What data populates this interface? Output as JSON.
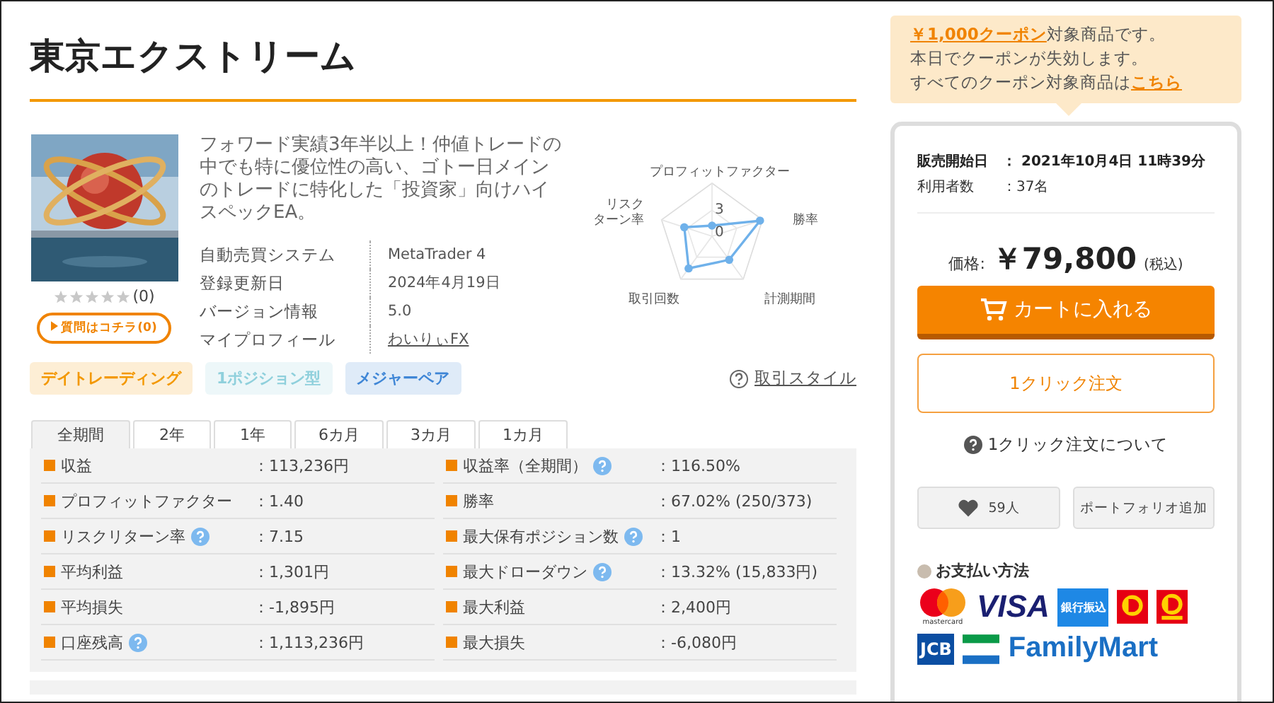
{
  "title": "東京エクストリーム",
  "product": {
    "rating_count": "(0)",
    "stars": 0,
    "question_button": "質問はコチラ(0)",
    "description": "フォワード実績3年半以上！仲値トレードの中でも特に優位性の高い、ゴトー日メインのトレードに特化した「投資家」向けハイスペックEA。",
    "specs": [
      {
        "label": "自動売買システム",
        "value": "MetaTrader 4",
        "link": false
      },
      {
        "label": "登録更新日",
        "value": "2024年4月19日",
        "link": false
      },
      {
        "label": "バージョン情報",
        "value": "5.0",
        "link": false
      },
      {
        "label": "マイプロフィール",
        "value": "わいりぃFX",
        "link": true
      }
    ],
    "tags": [
      {
        "label": "デイトレーディング",
        "color": "#f39800"
      },
      {
        "label": "1ポジション型",
        "color": "#8fd0dc"
      },
      {
        "label": "メジャーペア",
        "color": "#3f86d6"
      }
    ]
  },
  "radar": {
    "axes": [
      {
        "lines": [
          "プロフィットファクター"
        ]
      },
      {
        "lines": [
          "勝率"
        ]
      },
      {
        "lines": [
          "計測期間"
        ]
      },
      {
        "lines": [
          "取引回数"
        ]
      },
      {
        "lines": [
          "リスク",
          "ターン率"
        ]
      }
    ],
    "tick_high": "3",
    "tick_low": "0",
    "style_link": "取引スタイル"
  },
  "period_tabs": [
    {
      "label": "全期間",
      "selected": true
    },
    {
      "label": "2年",
      "selected": false
    },
    {
      "label": "1年",
      "selected": false
    },
    {
      "label": "6カ月",
      "selected": false
    },
    {
      "label": "3カ月",
      "selected": false
    },
    {
      "label": "1カ月",
      "selected": false
    }
  ],
  "stats_left": [
    {
      "label": "収益",
      "help": false,
      "value": "：113,236円"
    },
    {
      "label": "プロフィットファクター",
      "help": false,
      "value": "：1.40"
    },
    {
      "label": "リスクリターン率",
      "help": true,
      "value": "：7.15"
    },
    {
      "label": "平均利益",
      "help": false,
      "value": "：1,301円"
    },
    {
      "label": "平均損失",
      "help": false,
      "value": "：-1,895円"
    },
    {
      "label": "口座残高",
      "help": true,
      "value": "：1,113,236円"
    }
  ],
  "stats_right": [
    {
      "label": "収益率（全期間）",
      "help": true,
      "value": "：116.50%"
    },
    {
      "label": "勝率",
      "help": false,
      "value": "：67.02% (250/373)"
    },
    {
      "label": "最大保有ポジション数",
      "help": true,
      "value": "：1"
    },
    {
      "label": "最大ドローダウン",
      "help": true,
      "value": "：13.32% (15,833円)"
    },
    {
      "label": "最大利益",
      "help": false,
      "value": "：2,400円"
    },
    {
      "label": "最大損失",
      "help": false,
      "value": "：-6,080円"
    }
  ],
  "coupon": {
    "link": "￥1,000クーポン",
    "line1_rest": "対象商品です。",
    "line2": "本日でクーポンが失効します。",
    "line3": "すべてのクーポン対象商品は",
    "line3_link": "こちら"
  },
  "sale": {
    "start_label": "販売開始日",
    "start_value": "：  2021年10月4日 11時39分",
    "users_label": "利用者数",
    "users_value": "：37名",
    "price_label": "価格:",
    "price": "￥79,800",
    "tax": "(税込)",
    "cart_button": "カートに入れる",
    "one_click_button": "1クリック注文",
    "one_click_help": "1クリック注文について",
    "favorite_count": "59人",
    "portfolio_button": "ポートフォリオ追加"
  },
  "payment": {
    "heading": "お支払い方法",
    "mastercard": "mastercard",
    "visa": "VISA",
    "bank": "銀行振込",
    "jcb": "JCB",
    "familymart": "FamilyMart"
  }
}
